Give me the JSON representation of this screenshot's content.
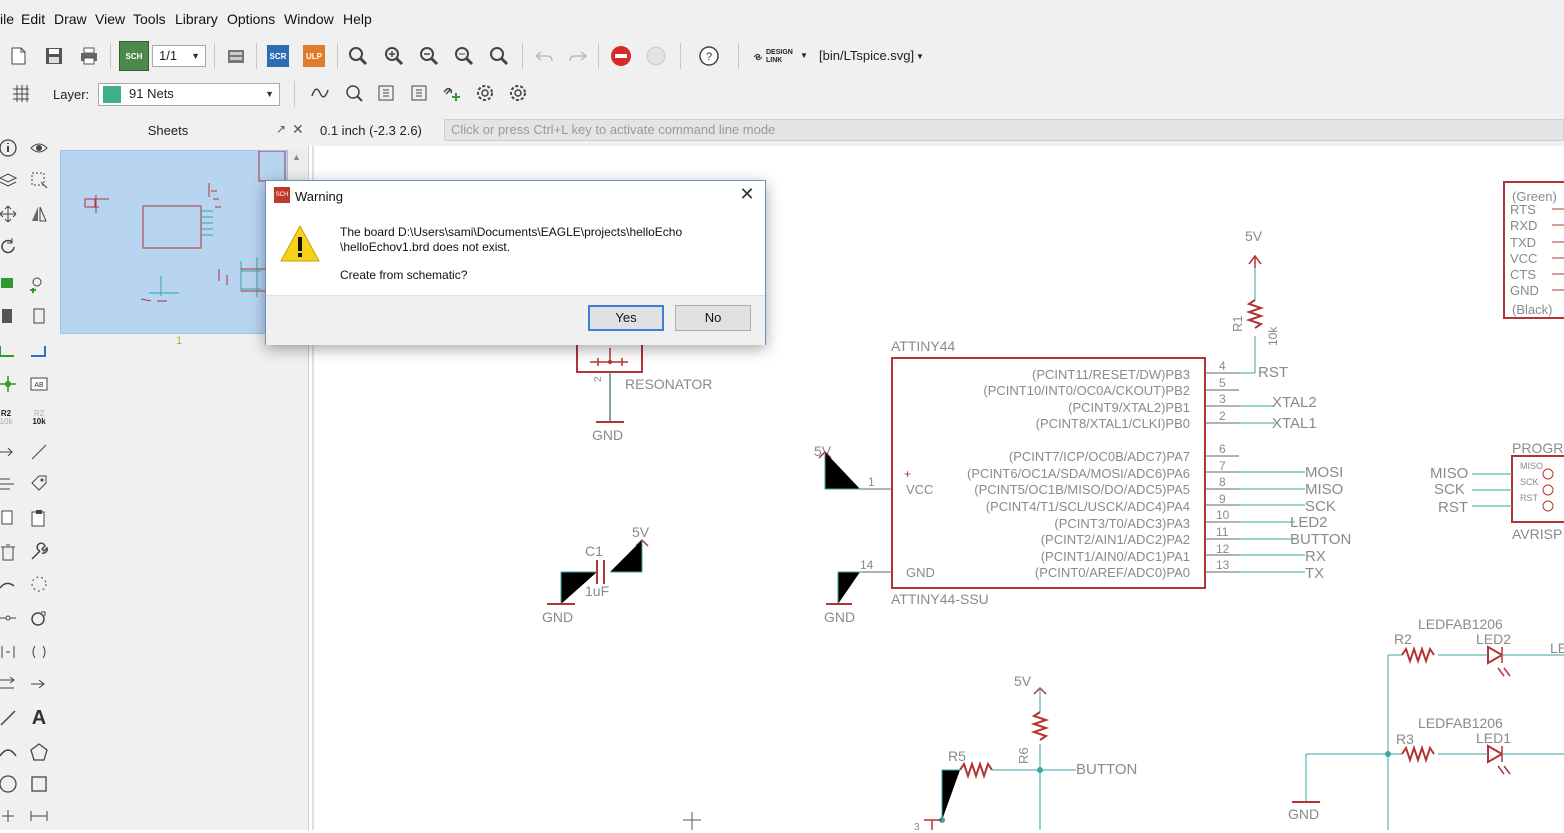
{
  "menubar": {
    "items": [
      "ile",
      "Edit",
      "Draw",
      "View",
      "Tools",
      "Library",
      "Options",
      "Window",
      "Help"
    ]
  },
  "toolbar": {
    "sheet_selector": "1/1",
    "scr_label": "SCR",
    "ulp_label": "ULP",
    "sch_label": "SCH",
    "design_link": "DESIGN LINK",
    "script_label": "[bin/LTspice.svg]",
    "help_label": "?"
  },
  "toolbar2": {
    "layer_label": "Layer:",
    "layer_value": "91 Nets",
    "layer_color": "#3fb089"
  },
  "sheets_panel": {
    "title": "Sheets",
    "sheet_number": "1"
  },
  "coord": {
    "readout": "0.1 inch (-2.3 2.6)",
    "command_placeholder": "Click or press Ctrl+L key to activate command line mode"
  },
  "lefttools": {
    "r2_label": "R2",
    "r2_value": "10k",
    "text_label": "A"
  },
  "dialog": {
    "title": "Warning",
    "message_line1": "The board D:\\Users\\sami\\Documents\\EAGLE\\projects\\helloEcho",
    "message_line2": "\\helloEchov1.brd does not exist.",
    "question": "Create from schematic?",
    "yes_label": "Yes",
    "no_label": "No"
  },
  "schematic": {
    "colors": {
      "part": "#b33434",
      "net": "#3aa6a6",
      "text": "#8a8a8a",
      "pin": "#666666"
    },
    "ic": {
      "name": "ATTINY44",
      "value": "ATTINY44-SSU",
      "vcc": "VCC",
      "gnd": "GND",
      "pins_right": [
        {
          "num": "4",
          "label": "(PCINT11/RESET/DW)PB3",
          "net": "RST"
        },
        {
          "num": "5",
          "label": "(PCINT10/INT0/OC0A/CKOUT)PB2",
          "net": ""
        },
        {
          "num": "3",
          "label": "(PCINT9/XTAL2)PB1",
          "net": "XTAL2"
        },
        {
          "num": "2",
          "label": "(PCINT8/XTAL1/CLKI)PB0",
          "net": "XTAL1"
        },
        {
          "num": "6",
          "label": "(PCINT7/ICP/OC0B/ADC7)PA7",
          "net": ""
        },
        {
          "num": "7",
          "label": "(PCINT6/OC1A/SDA/MOSI/ADC6)PA6",
          "net": "MOSI"
        },
        {
          "num": "8",
          "label": "(PCINT5/OC1B/MISO/DO/ADC5)PA5",
          "net": "MISO"
        },
        {
          "num": "9",
          "label": "(PCINT4/T1/SCL/USCK/ADC4)PA4",
          "net": "SCK"
        },
        {
          "num": "10",
          "label": "(PCINT3/T0/ADC3)PA3",
          "net": "LED2"
        },
        {
          "num": "11",
          "label": "(PCINT2/AIN1/ADC2)PA2",
          "net": "BUTTON"
        },
        {
          "num": "12",
          "label": "(PCINT1/AIN0/ADC1)PA1",
          "net": "RX"
        },
        {
          "num": "13",
          "label": "(PCINT0/AREF/ADC0)PA0",
          "net": "TX"
        }
      ],
      "pin_vcc_num": "1",
      "pin_gnd_num": "14"
    },
    "resonator": {
      "label": "RESONATOR",
      "pin2": "2",
      "gnd": "GND"
    },
    "cap": {
      "name": "C1",
      "value": "1uF",
      "supply": "5V",
      "gnd": "GND"
    },
    "vcc_supply": "5V",
    "ic_gnd": "GND",
    "r1": {
      "name": "R1",
      "value": "10k",
      "supply": "5V"
    },
    "ftdi": {
      "labels": [
        "(Green)",
        "RTS",
        "RXD",
        "TXD",
        "VCC",
        "CTS",
        "GND",
        "(Black)"
      ]
    },
    "avrisp": {
      "name": "PROGR",
      "value": "AVRISP",
      "pins": [
        "MISO",
        "SCK",
        "RST"
      ],
      "nets": [
        "MISO",
        "SCK",
        "RST"
      ]
    },
    "r2": {
      "name": "R2"
    },
    "led2": {
      "pkg": "LEDFAB1206",
      "name": "LED2",
      "net_cut": "LE"
    },
    "r3": {
      "name": "R3"
    },
    "led1": {
      "pkg": "LEDFAB1206",
      "name": "LED1"
    },
    "gnd_bottom": "GND",
    "r5": {
      "name": "R5"
    },
    "r6": {
      "name": "R6",
      "supply": "5V",
      "net": "BUTTON"
    },
    "partial_r": "+RA",
    "pin_3": "3"
  }
}
